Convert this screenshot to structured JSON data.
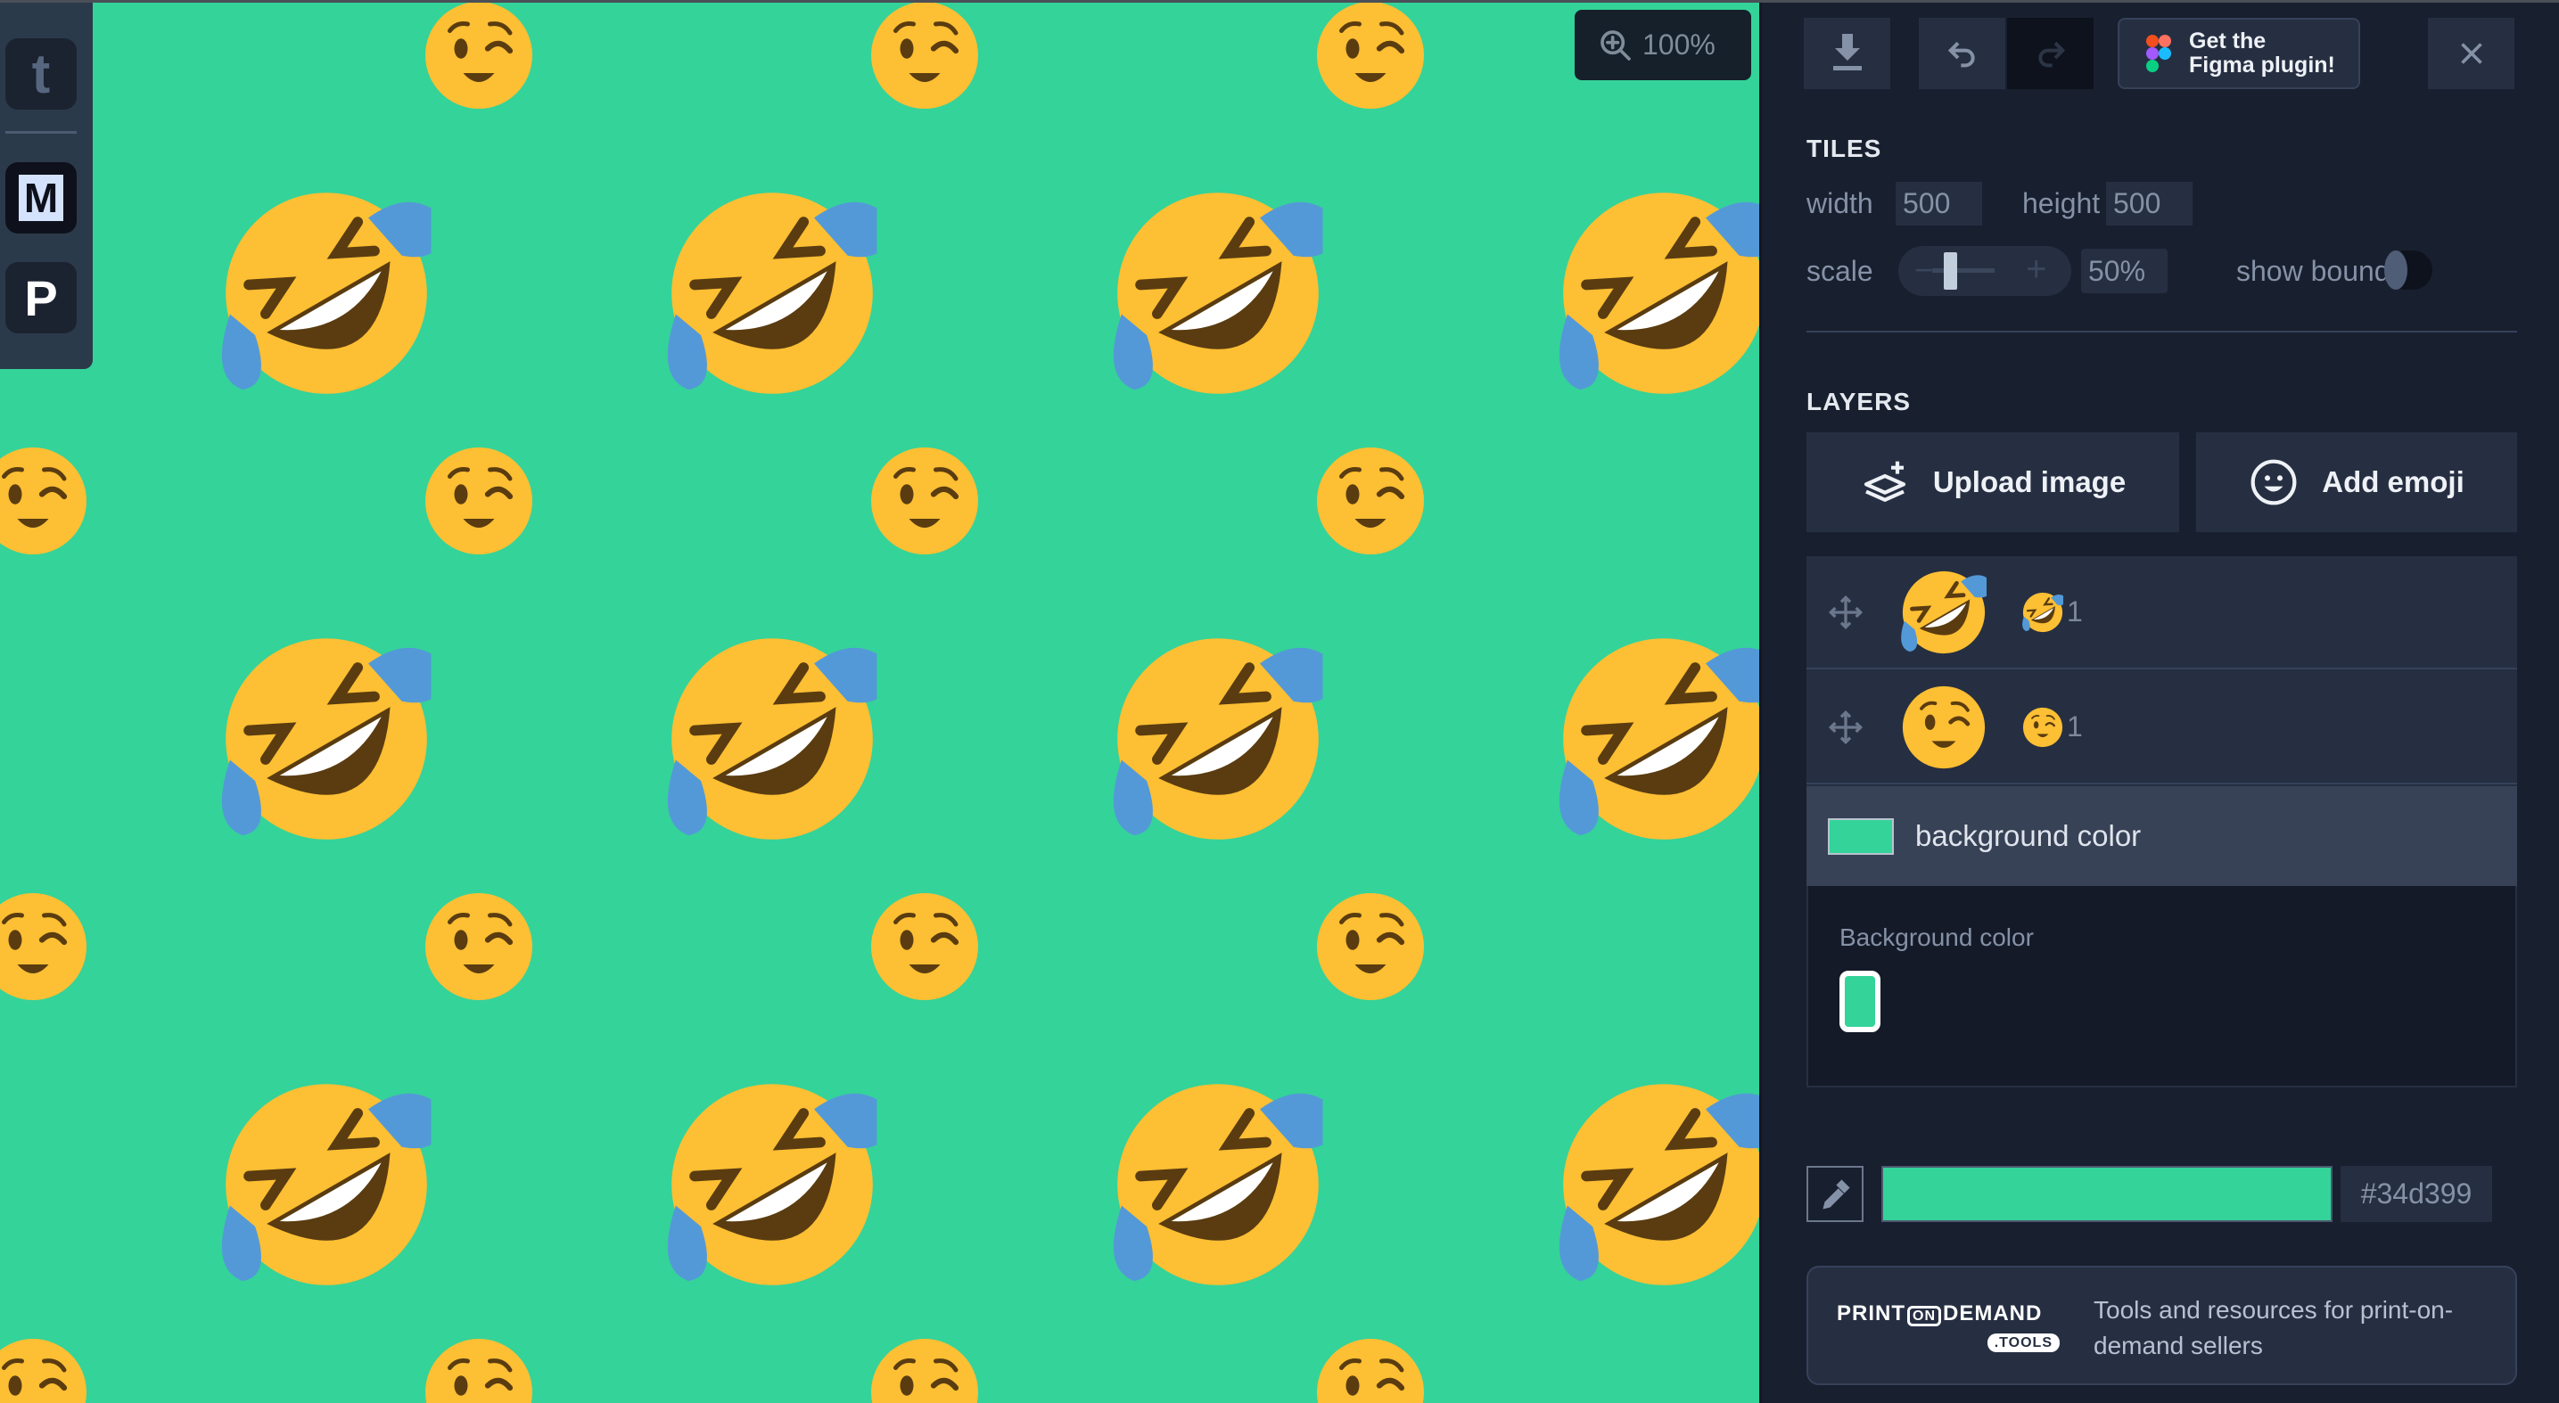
{
  "canvas": {
    "background": "#34d399",
    "zoom_label": "100%",
    "emojis": [
      "rolling-on-floor-laughing",
      "winking-face"
    ]
  },
  "sidebar": {
    "items": [
      {
        "label": "t"
      },
      {
        "label": "M"
      },
      {
        "label": "P"
      }
    ]
  },
  "toolbar": {
    "figma_line1": "Get the",
    "figma_line2": "Figma plugin!"
  },
  "tiles": {
    "heading": "TILES",
    "width_label": "width",
    "width_value": "500",
    "height_label": "height",
    "height_value": "500",
    "scale_label": "scale",
    "scale_minus": "−",
    "scale_plus": "+",
    "scale_value": "50%",
    "scale_fraction": 0.5,
    "show_bounds_label": "show bounds",
    "show_bounds_on": false
  },
  "layers": {
    "heading": "LAYERS",
    "upload_label": "Upload image",
    "add_emoji_label": "Add emoji",
    "items": [
      {
        "emoji": "rolling-on-floor-laughing",
        "count": "1"
      },
      {
        "emoji": "winking-face",
        "count": "1"
      }
    ],
    "bg_row_label": "background color",
    "bg_panel_label": "Background color"
  },
  "color": {
    "hex": "#34d399"
  },
  "promo": {
    "logo_text": "PRINT ON DEMAND .TOOLS",
    "logo_print": "PRINT",
    "logo_on": "ON",
    "logo_demand": "DEMAND",
    "logo_tools": ".TOOLS",
    "text": "Tools and resources for print-on-demand sellers"
  }
}
